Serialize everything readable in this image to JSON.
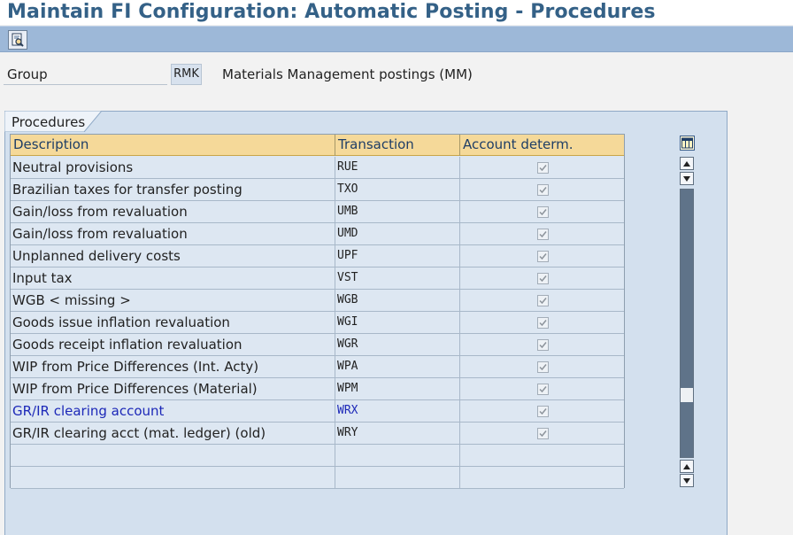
{
  "title": "Maintain FI Configuration: Automatic Posting - Procedures",
  "toolbar": {
    "icon": "document-search-icon"
  },
  "group": {
    "label": "Group",
    "value": "RMK",
    "description": "Materials Management postings (MM)"
  },
  "panel": {
    "title": "Procedures"
  },
  "table": {
    "columns": [
      "Description",
      "Transaction",
      "Account determ."
    ],
    "rows": [
      {
        "description": "Neutral provisions",
        "transaction": "RUE",
        "account_determ": true
      },
      {
        "description": "Brazilian taxes for transfer posting",
        "transaction": "TXO",
        "account_determ": true
      },
      {
        "description": "Gain/loss from revaluation",
        "transaction": "UMB",
        "account_determ": true
      },
      {
        "description": "Gain/loss from revaluation",
        "transaction": "UMD",
        "account_determ": true
      },
      {
        "description": "Unplanned delivery costs",
        "transaction": "UPF",
        "account_determ": true
      },
      {
        "description": "Input tax",
        "transaction": "VST",
        "account_determ": true
      },
      {
        "description": "WGB < missing >",
        "transaction": "WGB",
        "account_determ": true
      },
      {
        "description": "Goods issue inflation revaluation",
        "transaction": "WGI",
        "account_determ": true
      },
      {
        "description": "Goods receipt inflation revaluation",
        "transaction": "WGR",
        "account_determ": true
      },
      {
        "description": "WIP from Price Differences (Int. Acty)",
        "transaction": "WPA",
        "account_determ": true
      },
      {
        "description": "WIP from Price Differences (Material)",
        "transaction": "WPM",
        "account_determ": true
      },
      {
        "description": "GR/IR clearing account",
        "transaction": "WRX",
        "account_determ": true,
        "highlighted": true
      },
      {
        "description": "GR/IR clearing acct (mat. ledger) (old)",
        "transaction": "WRY",
        "account_determ": true
      },
      {
        "description": "",
        "transaction": "",
        "account_determ": false,
        "empty": true
      },
      {
        "description": "",
        "transaction": "",
        "account_determ": false,
        "empty": true
      }
    ]
  },
  "colors": {
    "title": "#346187",
    "header_bg": "#f5d999",
    "highlight_text": "#1c28b8"
  }
}
